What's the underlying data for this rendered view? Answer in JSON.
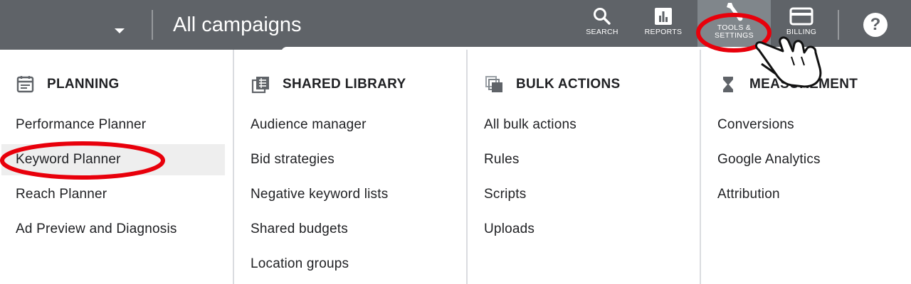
{
  "header": {
    "title": "All campaigns",
    "nav": [
      {
        "id": "search",
        "label": "SEARCH",
        "icon": "search-icon"
      },
      {
        "id": "reports",
        "label": "REPORTS",
        "icon": "bar-chart-icon"
      },
      {
        "id": "tools",
        "label": "TOOLS & SETTINGS",
        "icon": "wrench-icon",
        "active": true
      },
      {
        "id": "billing",
        "label": "BILLING",
        "icon": "credit-card-icon"
      }
    ],
    "help_glyph": "?"
  },
  "menu": {
    "columns": [
      {
        "heading": "PLANNING",
        "icon": "calendar-icon",
        "items": [
          "Performance Planner",
          "Keyword Planner",
          "Reach Planner",
          "Ad Preview and Diagnosis"
        ]
      },
      {
        "heading": "SHARED LIBRARY",
        "icon": "library-icon",
        "items": [
          "Audience manager",
          "Bid strategies",
          "Negative keyword lists",
          "Shared budgets",
          "Location groups"
        ]
      },
      {
        "heading": "BULK ACTIONS",
        "icon": "bulk-actions-icon",
        "items": [
          "All bulk actions",
          "Rules",
          "Scripts",
          "Uploads"
        ]
      },
      {
        "heading": "MEASUREMENT",
        "icon": "hourglass-icon",
        "items": [
          "Conversions",
          "Google Analytics",
          "Attribution"
        ]
      }
    ],
    "highlighted_item": "Keyword Planner"
  },
  "annotations": {
    "circle_color": "#e8000b",
    "pointer": "hand-pointer-icon"
  },
  "colors": {
    "topbar": "#5f6368",
    "active_tab": "#80868b",
    "text": "#202124",
    "divider": "#dadce0",
    "highlight_row": "#eeeeee"
  }
}
